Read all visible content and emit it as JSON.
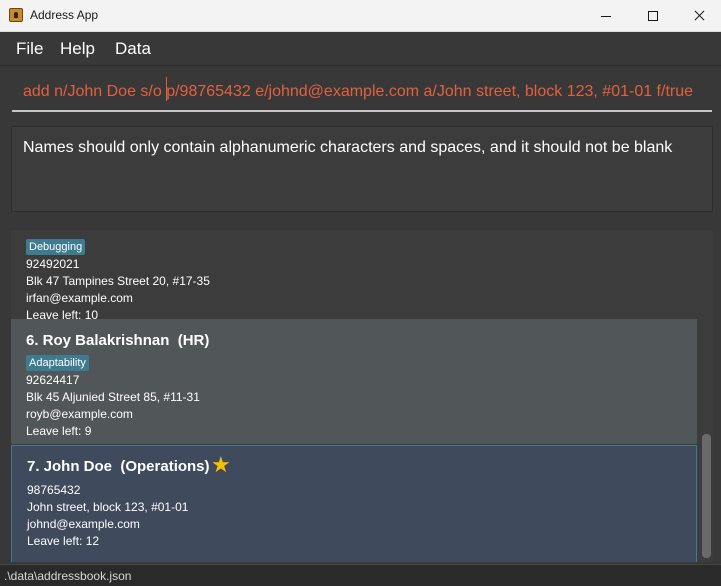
{
  "window": {
    "title": "Address App",
    "app_icon": "address-book-icon",
    "controls": {
      "minimize": "minimize-icon",
      "maximize": "maximize-icon",
      "close": "close-icon"
    }
  },
  "menu": [
    "File",
    "Help",
    "Data"
  ],
  "command_box": {
    "value": "add n/John Doe s/o p/98765432 e/johnd@example.com a/John street, block 123, #01-01 f/true"
  },
  "result_display": {
    "message": "Names should only contain alphanumeric characters and spaces, and it should not be blank"
  },
  "person_list": [
    {
      "name": "",
      "tags": [
        "Debugging"
      ],
      "phone": "92492021",
      "address": "Blk 47 Tampines Street 20, #17-35",
      "email": "irfan@example.com",
      "leave": "Leave left: 10"
    },
    {
      "name": "6. Roy Balakrishnan  (HR)",
      "tags": [
        "Adaptability"
      ],
      "phone": "92624417",
      "address": "Blk 45 Aljunied Street 85, #11-31",
      "email": "royb@example.com",
      "leave": "Leave left: 9"
    },
    {
      "name": "7. John Doe  (Operations)",
      "favourite_icon": "star-icon",
      "tags": [],
      "phone": "98765432",
      "address": "John street, block 123, #01-01",
      "email": "johnd@example.com",
      "leave": "Leave left: 12",
      "selected": true
    }
  ],
  "status_bar": {
    "path": ".\\data\\addressbook.json"
  },
  "colors": {
    "background": "#383838",
    "card_dark": "#3c3c3c",
    "card_light": "#515658",
    "card_selected": "#3f4a5c",
    "tag": "#3e7b91",
    "command_text": "#e3603f",
    "star": "#f5c400"
  }
}
